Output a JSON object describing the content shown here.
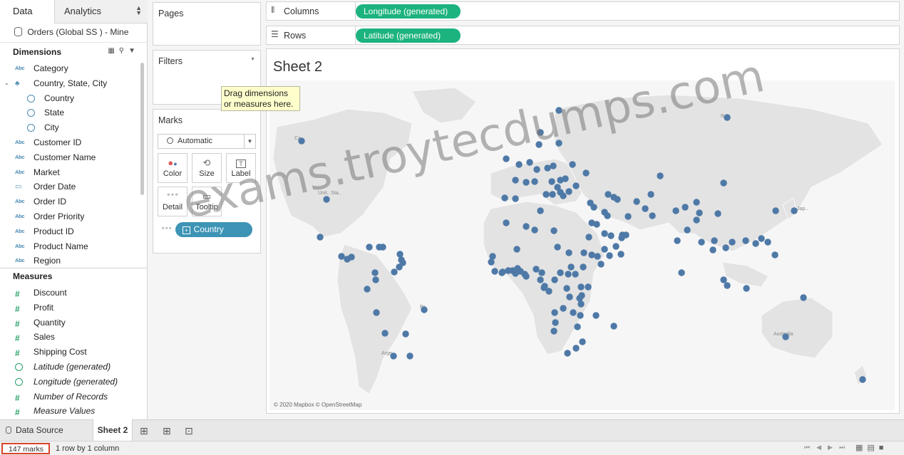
{
  "tabs": {
    "data": "Data",
    "analytics": "Analytics"
  },
  "datasource": "Orders (Global SS ) - Mine",
  "dimensions": {
    "heading": "Dimensions",
    "items": [
      {
        "icon": "Abc",
        "label": "Category"
      },
      {
        "icon": "hier",
        "label": "Country, State, City"
      },
      {
        "icon": "globe",
        "label": "Country",
        "sub": true
      },
      {
        "icon": "globe",
        "label": "State",
        "sub": true
      },
      {
        "icon": "globe",
        "label": "City",
        "sub": true
      },
      {
        "icon": "Abc",
        "label": "Customer ID"
      },
      {
        "icon": "Abc",
        "label": "Customer Name"
      },
      {
        "icon": "Abc",
        "label": "Market"
      },
      {
        "icon": "cal",
        "label": "Order Date"
      },
      {
        "icon": "Abc",
        "label": "Order ID"
      },
      {
        "icon": "Abc",
        "label": "Order Priority"
      },
      {
        "icon": "Abc",
        "label": "Product ID"
      },
      {
        "icon": "Abc",
        "label": "Product Name"
      },
      {
        "icon": "Abc",
        "label": "Region"
      }
    ]
  },
  "measures": {
    "heading": "Measures",
    "items": [
      {
        "icon": "#",
        "label": "Discount"
      },
      {
        "icon": "#",
        "label": "Profit"
      },
      {
        "icon": "#",
        "label": "Quantity"
      },
      {
        "icon": "#",
        "label": "Sales"
      },
      {
        "icon": "#",
        "label": "Shipping Cost"
      },
      {
        "icon": "globe",
        "label": "Latitude (generated)",
        "italic": true
      },
      {
        "icon": "globe",
        "label": "Longitude (generated)",
        "italic": true
      },
      {
        "icon": "#",
        "label": "Number of Records",
        "italic": true
      },
      {
        "icon": "#",
        "label": "Measure Values",
        "italic": true
      }
    ]
  },
  "cards": {
    "pages": "Pages",
    "filters": "Filters",
    "marks": "Marks"
  },
  "tooltip": "Drag dimensions or measures here.",
  "marks": {
    "type": "Automatic",
    "buttons": {
      "color": "Color",
      "size": "Size",
      "label": "Label",
      "detail": "Detail",
      "tooltip": "Tooltip"
    },
    "pill": "Country"
  },
  "shelves": {
    "columns_label": "Columns",
    "columns_pill": "Longitude (generated)",
    "rows_label": "Rows",
    "rows_pill": "Latitude (generated)"
  },
  "sheet_title": "Sheet 2",
  "attribution": "© 2020 Mapbox © OpenStreetMap",
  "map_labels": {
    "ru": "R..",
    "ca": "Ca..",
    "us": "Unit.. Sta..",
    "br": "Br..",
    "au": "Australia",
    "jp": "Jap..",
    "ar": "Arge.."
  },
  "colors": {
    "mark": "#4e79a7",
    "pill_green": "#1cb37e",
    "pill_blue": "#3d94b5",
    "marks_border": "#d9452b"
  },
  "bottom_tabs": {
    "datasource": "Data Source",
    "sheet": "Sheet 2"
  },
  "status": {
    "marks": "147 marks",
    "dims": "1 row by 1 column"
  },
  "watermark": "exams.troytecdumps.com"
}
